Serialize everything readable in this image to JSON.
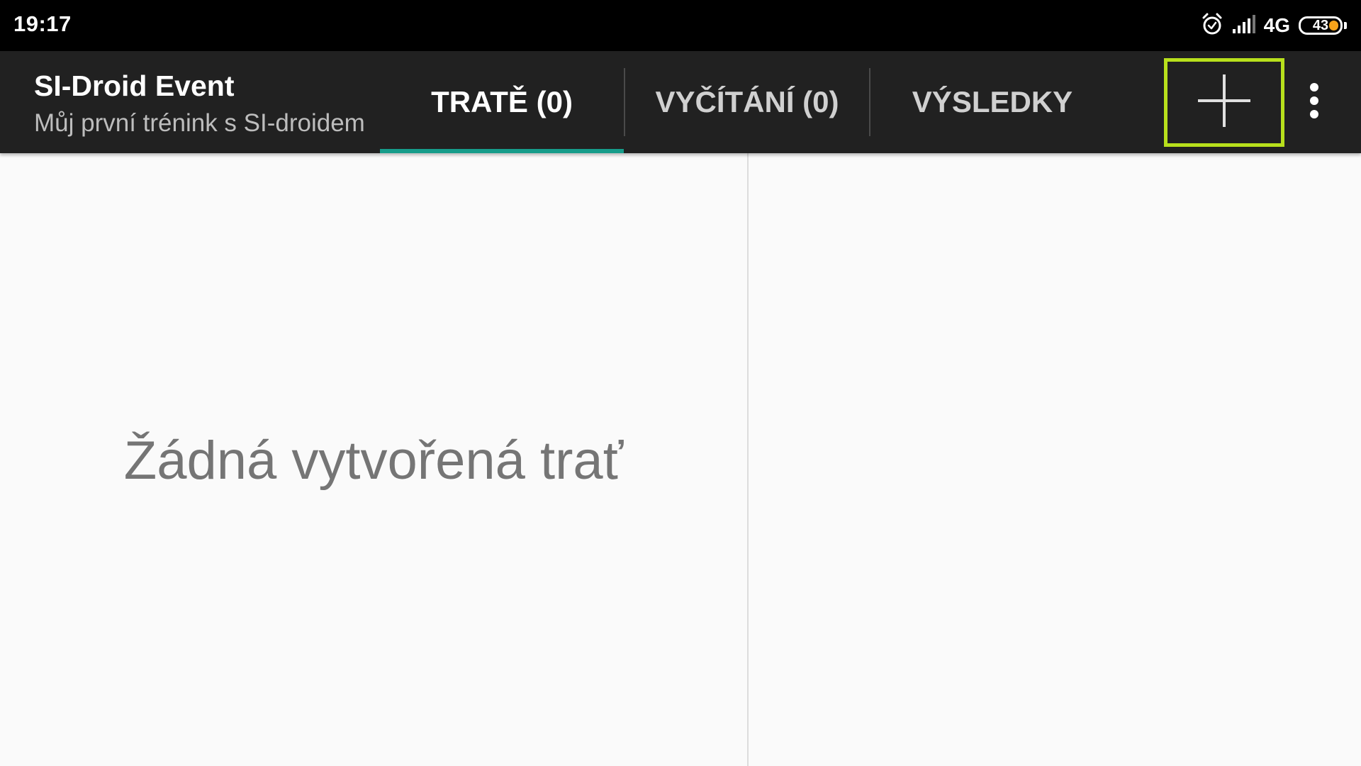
{
  "status_bar": {
    "time": "19:17",
    "network": "4G",
    "battery": "43",
    "icons": [
      "alarm-icon",
      "signal-icon",
      "battery-icon"
    ],
    "battery_color": "#f5a31a"
  },
  "app_bar": {
    "title": "SI-Droid Event",
    "subtitle": "Můj první trénink s SI-droidem",
    "tabs": [
      {
        "label": "TRATĚ (0)",
        "selected": true
      },
      {
        "label": "VYČÍTÁNÍ (0)",
        "selected": false
      },
      {
        "label": "VÝSLEDKY",
        "selected": false
      }
    ],
    "actions": {
      "add_icon": "plus-icon",
      "overflow_icon": "more-vert-icon"
    },
    "colors": {
      "background": "#212121",
      "tab_indicator": "#169c8a",
      "highlight_border": "#b8e01c"
    }
  },
  "content": {
    "empty_message": "Žádná vytvořená trať"
  }
}
